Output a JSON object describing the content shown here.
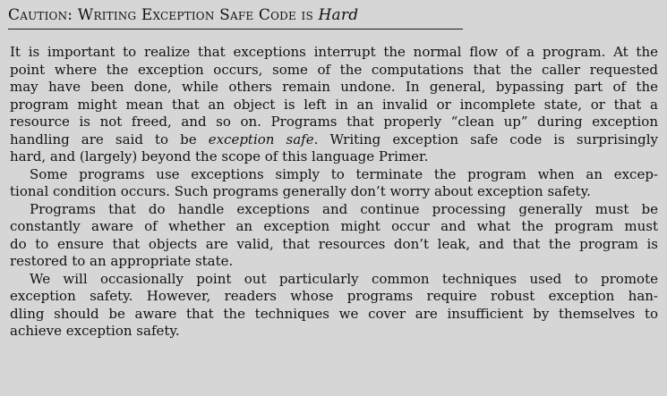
{
  "heading": {
    "prefix": "Caution: Writing Exception Safe Code is ",
    "emphasis": "Hard"
  },
  "paragraphs": [
    {
      "lines": [
        "It is important to realize that exceptions interrupt the normal flow of a program. At the",
        "point where the exception occurs, some of the computations that the caller requested",
        "may have been done, while others remain undone. In general, bypassing part of the",
        "program might mean that an object is left in an invalid or incomplete state, or that a",
        "resource is not freed, and so on. Programs that properly “clean up” during exception"
      ],
      "line6_before": "handling are said to be ",
      "line6_em": "exception safe",
      "line6_after": ". Writing exception safe code is surprisingly",
      "line7": "hard, and (largely) beyond the scope of this language Primer."
    },
    {
      "lines": [
        "Some programs use exceptions simply to terminate the program when an excep-",
        "tional condition occurs. Such programs generally don’t worry about exception safety."
      ]
    },
    {
      "lines": [
        "Programs that do handle exceptions and continue processing generally must be",
        "constantly aware of whether an exception might occur and what the program must",
        "do to ensure that objects are valid, that resources don’t leak, and that the program is",
        "restored to an appropriate state."
      ]
    },
    {
      "lines": [
        "We will occasionally point out particularly common techniques used to promote",
        "exception safety. However, readers whose programs require robust exception han-",
        "dling should be aware that the techniques we cover are insufficient by themselves to",
        "achieve exception safety."
      ]
    }
  ]
}
